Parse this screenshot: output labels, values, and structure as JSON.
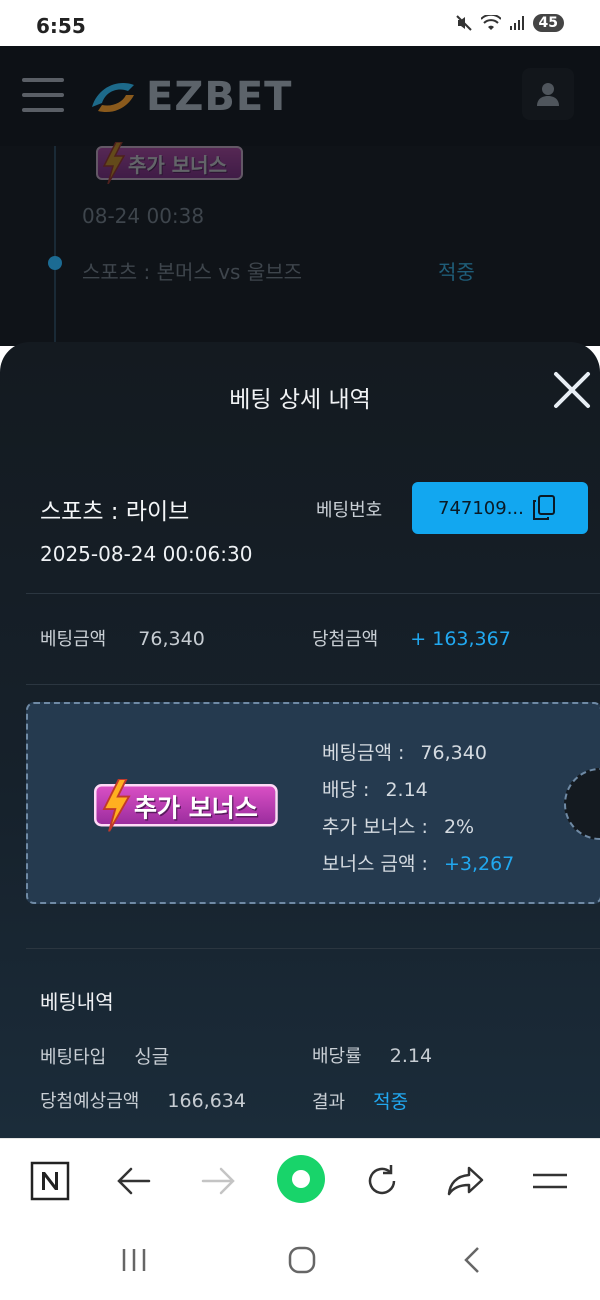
{
  "status_bar": {
    "time": "6:55",
    "battery": "45"
  },
  "app": {
    "logo_text": "EZBET"
  },
  "background_list": {
    "date": "08-24 00:38",
    "match": "스포츠 : 본머스 vs 울브즈",
    "status": "적중",
    "badge": "추가 보너스"
  },
  "sheet": {
    "title": "베팅 상세 내역",
    "category": "스포츠 : 라이브",
    "datetime": "2025-08-24 00:06:30",
    "bet_no_label": "베팅번호",
    "bet_no_value": "747109...",
    "bet_amount_label": "베팅금액",
    "bet_amount_value": "76,340",
    "win_amount_label": "당첨금액",
    "win_amount_value": "+ 163,367",
    "bonus": {
      "badge": "추가 보너스",
      "line1_label": "베팅금액 :",
      "line1_value": "76,340",
      "line2_label": "배당 :",
      "line2_value": "2.14",
      "line3_label": "추가 보너스 :",
      "line3_value": "2%",
      "line4_label": "보너스 금액 :",
      "line4_value": "+3,267"
    },
    "details": {
      "title": "베팅내역",
      "type_label": "베팅타입",
      "type_value": "싱글",
      "odds_label": "배당률",
      "odds_value": "2.14",
      "expected_label": "당첨예상금액",
      "expected_value": "166,634",
      "result_label": "결과",
      "result_value": "적중"
    }
  },
  "colors": {
    "accent": "#21a8f0",
    "button": "#12a7f0",
    "sheet_bg": "#16212b"
  }
}
